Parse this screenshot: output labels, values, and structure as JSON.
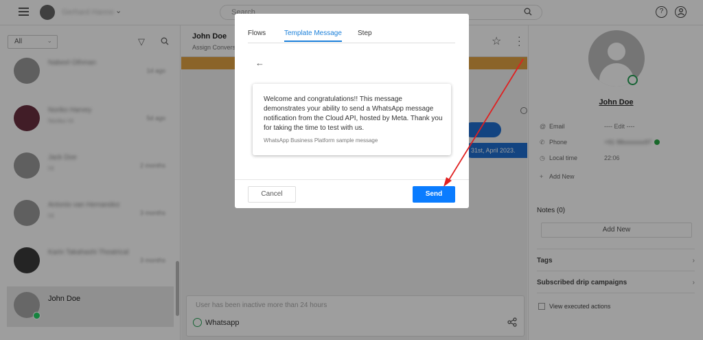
{
  "topbar": {
    "user_name": "Gerhard Hanne",
    "search_placeholder": "Search",
    "help_glyph": "?",
    "chevron_glyph": "⌄"
  },
  "left": {
    "filter": "All",
    "items": [
      {
        "name": "Nabeel Othman",
        "sub": "",
        "meta": "1d ago"
      },
      {
        "name": "Noriko Harvey",
        "sub": "Noriko Hi",
        "meta": "5d ago"
      },
      {
        "name": "Jack Doe",
        "sub": "Hi",
        "meta": "2 months"
      },
      {
        "name": "Antonio van Hernandez",
        "sub": "Hi",
        "meta": "3 months"
      },
      {
        "name": "Karin Takahashi Theatrical",
        "sub": "",
        "meta": "3 months"
      },
      {
        "name": "John Doe",
        "sub": "",
        "meta": ""
      }
    ]
  },
  "center": {
    "contact_name": "John Doe",
    "assign_text": "Assign Conversa",
    "bubble_text": "31st, April 2023.",
    "composer_placeholder": "User has been inactive more than 24 hours",
    "channel": "Whatsapp"
  },
  "right": {
    "name": "John Doe",
    "email_label": "Email",
    "email_value": "---- Edit ----",
    "phone_label": "Phone",
    "phone_value": "+91 98xxxxxxx97",
    "localtime_label": "Local time",
    "localtime_value": "22:06",
    "add_new_label": "Add New",
    "notes_title": "Notes (0)",
    "notes_add": "Add New",
    "tags": "Tags",
    "drip": "Subscribed drip campaigns",
    "view_exec": "View executed actions"
  },
  "modal": {
    "tabs": [
      "Flows",
      "Template Message",
      "Step"
    ],
    "active_tab": "Template Message",
    "template_body": "Welcome and congratulations!! This message demonstrates your ability to send a WhatsApp message notification from the Cloud API, hosted by Meta. Thank you for taking the time to test with us.",
    "template_footer": "WhatsApp Business Platform sample message",
    "cancel_label": "Cancel",
    "send_label": "Send"
  },
  "colors": {
    "primary": "#0a7cff",
    "tab_active": "#1a7fd9",
    "whatsapp_green": "#25d366",
    "warning_bar": "#e0a243",
    "annotation_red": "#e02020"
  }
}
